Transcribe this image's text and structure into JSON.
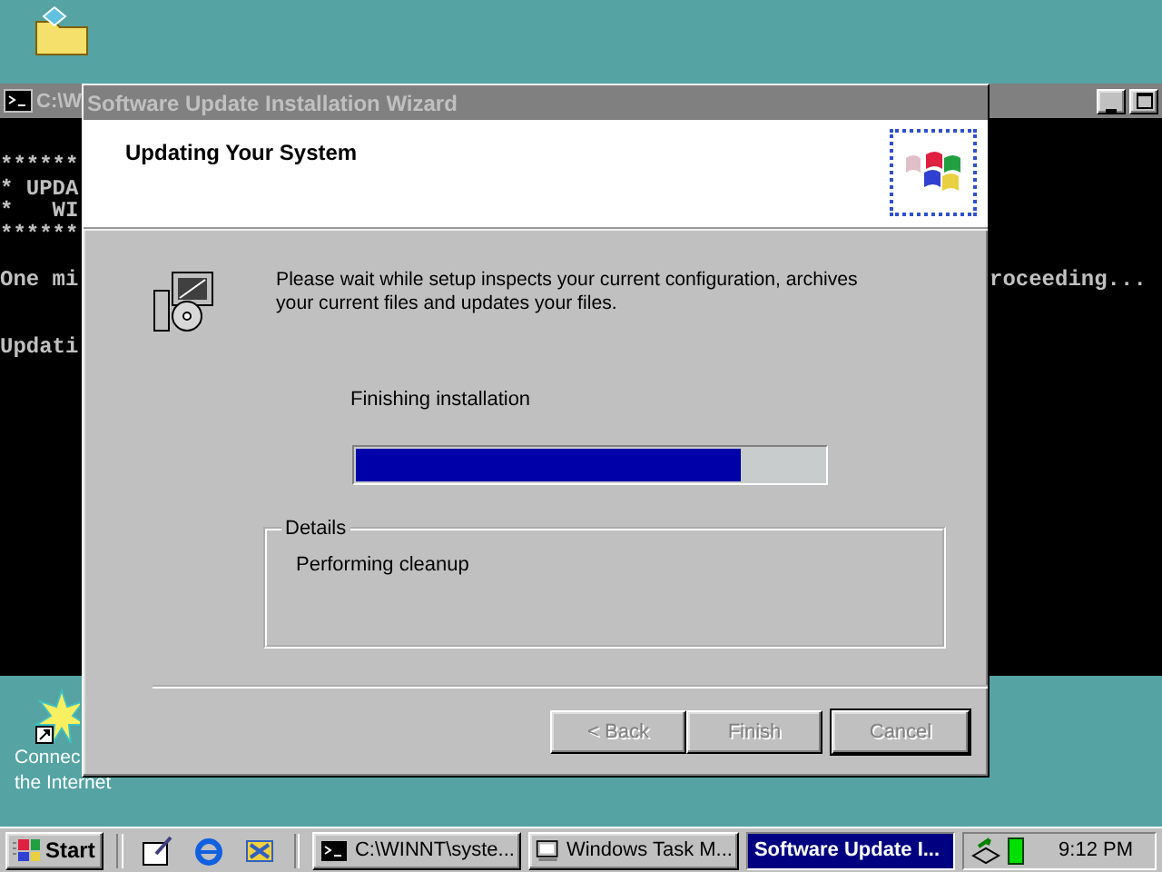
{
  "desktop_icons": [
    {
      "kind": "folder"
    },
    {
      "kind": "internet",
      "label_lines": [
        "Connec",
        "the Internet"
      ]
    }
  ],
  "console": {
    "title": "C:\\W",
    "lines": [
      {
        "kind": "text",
        "left": "******"
      },
      {
        "kind": "text",
        "left": "* UPDA"
      },
      {
        "kind": "text",
        "left": "*   WI"
      },
      {
        "kind": "text",
        "left": "******"
      },
      {
        "kind": "blank"
      },
      {
        "kind": "text",
        "left": "One mi",
        "right": "roceeding..."
      },
      {
        "kind": "blank"
      },
      {
        "kind": "blank"
      },
      {
        "kind": "text",
        "left": "Updati"
      }
    ]
  },
  "wizard": {
    "title": "Software Update Installation Wizard",
    "active": false,
    "heading": "Updating Your System",
    "message": "Please wait while setup inspects your current configuration, archives your current files and updates your files.",
    "status": "Finishing installation",
    "progress": {
      "level": 0.82
    },
    "details": {
      "legend": "Details",
      "text": "Performing cleanup"
    },
    "buttons": [
      {
        "label": "< Back",
        "disabled": true,
        "default": false
      },
      {
        "label": "Finish",
        "disabled": true,
        "default": false
      },
      {
        "label": "Cancel",
        "disabled": true,
        "default": true
      }
    ]
  },
  "taskbar": {
    "start": "Start",
    "quick_launch": [
      {
        "kind": "desktop"
      },
      {
        "kind": "browser"
      },
      {
        "kind": "channels"
      }
    ],
    "tasks": [
      {
        "label": "C:\\WINNT\\syste...",
        "kind": "console",
        "selected": false
      },
      {
        "label": "Windows Task M...",
        "kind": "monitor",
        "selected": false
      },
      {
        "label": "Software Update I...",
        "kind": "none",
        "selected": true
      }
    ],
    "clock": "9:12 PM"
  }
}
